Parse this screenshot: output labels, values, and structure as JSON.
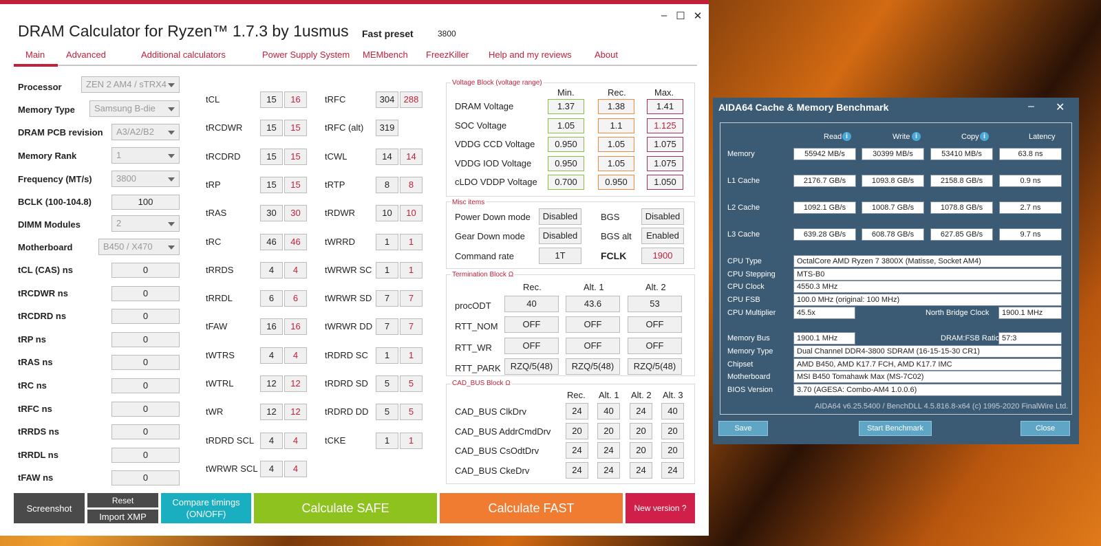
{
  "dram": {
    "title": "DRAM Calculator for Ryzen™ 1.7.3 by 1usmus",
    "preset_label": "Fast preset",
    "preset_value": "3800",
    "nav": [
      "Main",
      "Advanced",
      "Additional calculators",
      "Power Supply System",
      "MEMbench",
      "FreezKiller",
      "Help and my reviews",
      "About"
    ],
    "params": [
      {
        "label": "Processor",
        "value": "ZEN 2 AM4 / sTRX4"
      },
      {
        "label": "Memory Type",
        "value": "Samsung B-die"
      },
      {
        "label": "DRAM PCB revision",
        "value": "A3/A2/B2"
      },
      {
        "label": "Memory Rank",
        "value": "1"
      },
      {
        "label": "Frequency (MT/s)",
        "value": "3800"
      },
      {
        "label": "BCLK (100-104.8)",
        "value": "100"
      },
      {
        "label": "DIMM Modules",
        "value": "2"
      },
      {
        "label": "Motherboard",
        "value": "B450 / X470"
      }
    ],
    "ns": [
      {
        "label": "tCL (CAS) ns",
        "value": "0"
      },
      {
        "label": "tRCDWR ns",
        "value": "0"
      },
      {
        "label": "tRCDRD ns",
        "value": "0"
      },
      {
        "label": "tRP ns",
        "value": "0"
      },
      {
        "label": "tRAS ns",
        "value": "0"
      },
      {
        "label": "tRC ns",
        "value": "0"
      },
      {
        "label": "tRFC ns",
        "value": "0"
      },
      {
        "label": "tRRDS ns",
        "value": "0"
      },
      {
        "label": "tRRDL ns",
        "value": "0"
      },
      {
        "label": "tFAW ns",
        "value": "0"
      }
    ],
    "timings1": [
      {
        "label": "tCL",
        "a": "15",
        "b": "16"
      },
      {
        "label": "tRCDWR",
        "a": "15",
        "b": "15"
      },
      {
        "label": "tRCDRD",
        "a": "15",
        "b": "15"
      },
      {
        "label": "tRP",
        "a": "15",
        "b": "15"
      },
      {
        "label": "tRAS",
        "a": "30",
        "b": "30"
      },
      {
        "label": "tRC",
        "a": "46",
        "b": "46"
      },
      {
        "label": "tRRDS",
        "a": "4",
        "b": "4"
      },
      {
        "label": "tRRDL",
        "a": "6",
        "b": "6"
      },
      {
        "label": "tFAW",
        "a": "16",
        "b": "16"
      },
      {
        "label": "tWTRS",
        "a": "4",
        "b": "4"
      },
      {
        "label": "tWTRL",
        "a": "12",
        "b": "12"
      },
      {
        "label": "tWR",
        "a": "12",
        "b": "12"
      },
      {
        "label": "tRDRD SCL",
        "a": "4",
        "b": "4"
      },
      {
        "label": "tWRWR SCL",
        "a": "4",
        "b": "4"
      }
    ],
    "timings2": [
      {
        "label": "tRFC",
        "a": "304",
        "b": "288"
      },
      {
        "label": "tRFC (alt)",
        "a": "319",
        "b": ""
      },
      {
        "label": "tCWL",
        "a": "14",
        "b": "14"
      },
      {
        "label": "tRTP",
        "a": "8",
        "b": "8"
      },
      {
        "label": "tRDWR",
        "a": "10",
        "b": "10"
      },
      {
        "label": "tWRRD",
        "a": "1",
        "b": "1"
      },
      {
        "label": "tWRWR SC",
        "a": "1",
        "b": "1"
      },
      {
        "label": "tWRWR SD",
        "a": "7",
        "b": "7"
      },
      {
        "label": "tWRWR DD",
        "a": "7",
        "b": "7"
      },
      {
        "label": "tRDRD SC",
        "a": "1",
        "b": "1"
      },
      {
        "label": "tRDRD SD",
        "a": "5",
        "b": "5"
      },
      {
        "label": "tRDRD DD",
        "a": "5",
        "b": "5"
      },
      {
        "label": "tCKE",
        "a": "1",
        "b": "1"
      }
    ],
    "voltage": {
      "title": "Voltage Block (voltage range)",
      "headers": [
        "Min.",
        "Rec.",
        "Max."
      ],
      "rows": [
        {
          "label": "DRAM Voltage",
          "min": "1.37",
          "rec": "1.38",
          "max": "1.41"
        },
        {
          "label": "SOC Voltage",
          "min": "1.05",
          "rec": "1.1",
          "max": "1.125"
        },
        {
          "label": "VDDG  CCD Voltage",
          "min": "0.950",
          "rec": "1.05",
          "max": "1.075"
        },
        {
          "label": "VDDG  IOD Voltage",
          "min": "0.950",
          "rec": "1.05",
          "max": "1.075"
        },
        {
          "label": "cLDO VDDP Voltage",
          "min": "0.700",
          "rec": "0.950",
          "max": "1.050"
        }
      ]
    },
    "misc": {
      "title": "Misc items",
      "power_down_label": "Power Down mode",
      "power_down": "Disabled",
      "bgs_label": "BGS",
      "bgs": "Disabled",
      "gear_down_label": "Gear Down mode",
      "gear_down": "Disabled",
      "bgs_alt_label": "BGS alt",
      "bgs_alt": "Enabled",
      "cmd_rate_label": "Command rate",
      "cmd_rate": "1T",
      "fclk_label": "FCLK",
      "fclk": "1900"
    },
    "termination": {
      "title": "Termination Block Ω",
      "headers": [
        "Rec.",
        "Alt. 1",
        "Alt. 2"
      ],
      "rows": [
        {
          "label": "procODT",
          "v": [
            "40",
            "43.6",
            "53"
          ]
        },
        {
          "label": "RTT_NOM",
          "v": [
            "OFF",
            "OFF",
            "OFF"
          ]
        },
        {
          "label": "RTT_WR",
          "v": [
            "OFF",
            "OFF",
            "OFF"
          ]
        },
        {
          "label": "RTT_PARK",
          "v": [
            "RZQ/5(48)",
            "RZQ/5(48)",
            "RZQ/5(48)"
          ]
        }
      ]
    },
    "cad": {
      "title": "CAD_BUS Block Ω",
      "headers": [
        "Rec.",
        "Alt. 1",
        "Alt. 2",
        "Alt. 3"
      ],
      "rows": [
        {
          "label": "CAD_BUS ClkDrv",
          "v": [
            "24",
            "40",
            "24",
            "40"
          ]
        },
        {
          "label": "CAD_BUS AddrCmdDrv",
          "v": [
            "20",
            "20",
            "20",
            "20"
          ]
        },
        {
          "label": "CAD_BUS CsOdtDrv",
          "v": [
            "24",
            "24",
            "20",
            "20"
          ]
        },
        {
          "label": "CAD_BUS CkeDrv",
          "v": [
            "24",
            "24",
            "24",
            "24"
          ]
        }
      ]
    },
    "buttons": {
      "screenshot": "Screenshot",
      "reset": "Reset",
      "import_xmp": "Import XMP",
      "compare": "Compare timings (ON/OFF)",
      "safe": "Calculate SAFE",
      "fast": "Calculate FAST",
      "new_version": "New version ?"
    },
    "colors": {
      "accent": "#c0203a",
      "safe": "#8dc21f",
      "fast": "#f07c32",
      "compare": "#1aafc0",
      "dark": "#4a4a4a"
    }
  },
  "aida": {
    "title": "AIDA64 Cache & Memory Benchmark",
    "headers": [
      "Read",
      "Write",
      "Copy",
      "Latency"
    ],
    "rows": [
      {
        "label": "Memory",
        "v": [
          "55942 MB/s",
          "30399 MB/s",
          "53410 MB/s",
          "63.8 ns"
        ]
      },
      {
        "label": "L1 Cache",
        "v": [
          "2176.7 GB/s",
          "1093.8 GB/s",
          "2158.8 GB/s",
          "0.9 ns"
        ]
      },
      {
        "label": "L2 Cache",
        "v": [
          "1092.1 GB/s",
          "1008.7 GB/s",
          "1078.8 GB/s",
          "2.7 ns"
        ]
      },
      {
        "label": "L3 Cache",
        "v": [
          "639.28 GB/s",
          "608.78 GB/s",
          "627.85 GB/s",
          "9.7 ns"
        ]
      }
    ],
    "cpu_type_label": "CPU Type",
    "cpu_type": "OctalCore AMD Ryzen 7 3800X  (Matisse, Socket AM4)",
    "cpu_stepping_label": "CPU Stepping",
    "cpu_stepping": "MTS-B0",
    "cpu_clock_label": "CPU Clock",
    "cpu_clock": "4550.3 MHz",
    "cpu_fsb_label": "CPU FSB",
    "cpu_fsb": "100.0 MHz  (original: 100 MHz)",
    "cpu_mult_label": "CPU Multiplier",
    "cpu_mult": "45.5x",
    "nb_clock_label": "North Bridge Clock",
    "nb_clock": "1900.1 MHz",
    "mem_bus_label": "Memory Bus",
    "mem_bus": "1900.1 MHz",
    "ratio_label": "DRAM:FSB Ratio",
    "ratio": "57:3",
    "mem_type_label": "Memory Type",
    "mem_type": "Dual Channel DDR4-3800 SDRAM  (16-15-15-30 CR1)",
    "chipset_label": "Chipset",
    "chipset": "AMD B450, AMD K17.7 FCH, AMD K17.7 IMC",
    "mobo_label": "Motherboard",
    "mobo": "MSI B450 Tomahawk Max (MS-7C02)",
    "bios_label": "BIOS Version",
    "bios": "3.70  (AGESA: Combo-AM4 1.0.0.6)",
    "footer": "AIDA64 v6.25.5400 / BenchDLL 4.5.816.8-x64  (c) 1995-2020 FinalWire Ltd.",
    "save": "Save",
    "start": "Start Benchmark",
    "close": "Close"
  }
}
